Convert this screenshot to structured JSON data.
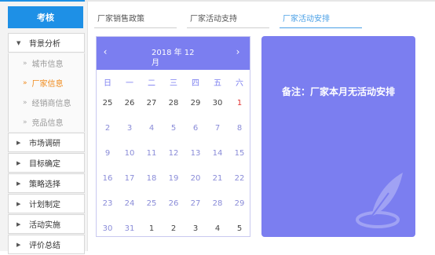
{
  "sidebar": {
    "header": "考核",
    "groups": [
      {
        "label": "背景分析",
        "open": true,
        "items": [
          "城市信息",
          "厂家信息",
          "经销商信息",
          "竞品信息"
        ],
        "active": "厂家信息"
      },
      {
        "label": "市场调研"
      },
      {
        "label": "目标确定"
      },
      {
        "label": "策略选择"
      },
      {
        "label": "计划制定"
      },
      {
        "label": "活动实施"
      },
      {
        "label": "评价总结"
      }
    ]
  },
  "tabs": [
    "厂家销售政策",
    "厂家活动支持",
    "厂家活动安排"
  ],
  "active_tab": "厂家活动安排",
  "calendar": {
    "title": "2018 年 12月",
    "prev": "‹",
    "next": "›",
    "weekdays": [
      "日",
      "一",
      "二",
      "三",
      "四",
      "五",
      "六"
    ],
    "rows": [
      [
        "25",
        "26",
        "27",
        "28",
        "29",
        "30",
        "1"
      ],
      [
        "2",
        "3",
        "4",
        "5",
        "6",
        "7",
        "8"
      ],
      [
        "9",
        "10",
        "11",
        "12",
        "13",
        "14",
        "15"
      ],
      [
        "16",
        "17",
        "18",
        "19",
        "20",
        "21",
        "22"
      ],
      [
        "23",
        "24",
        "25",
        "26",
        "27",
        "28",
        "29"
      ],
      [
        "30",
        "31",
        "1",
        "2",
        "3",
        "4",
        "5"
      ]
    ],
    "today": "1"
  },
  "note": "备注：厂家本月无活动安排",
  "colors": {
    "accent": "#1e90e6",
    "calendar": "#7b7ef0",
    "active_item": "#f08a1a",
    "today": "#e03030"
  }
}
